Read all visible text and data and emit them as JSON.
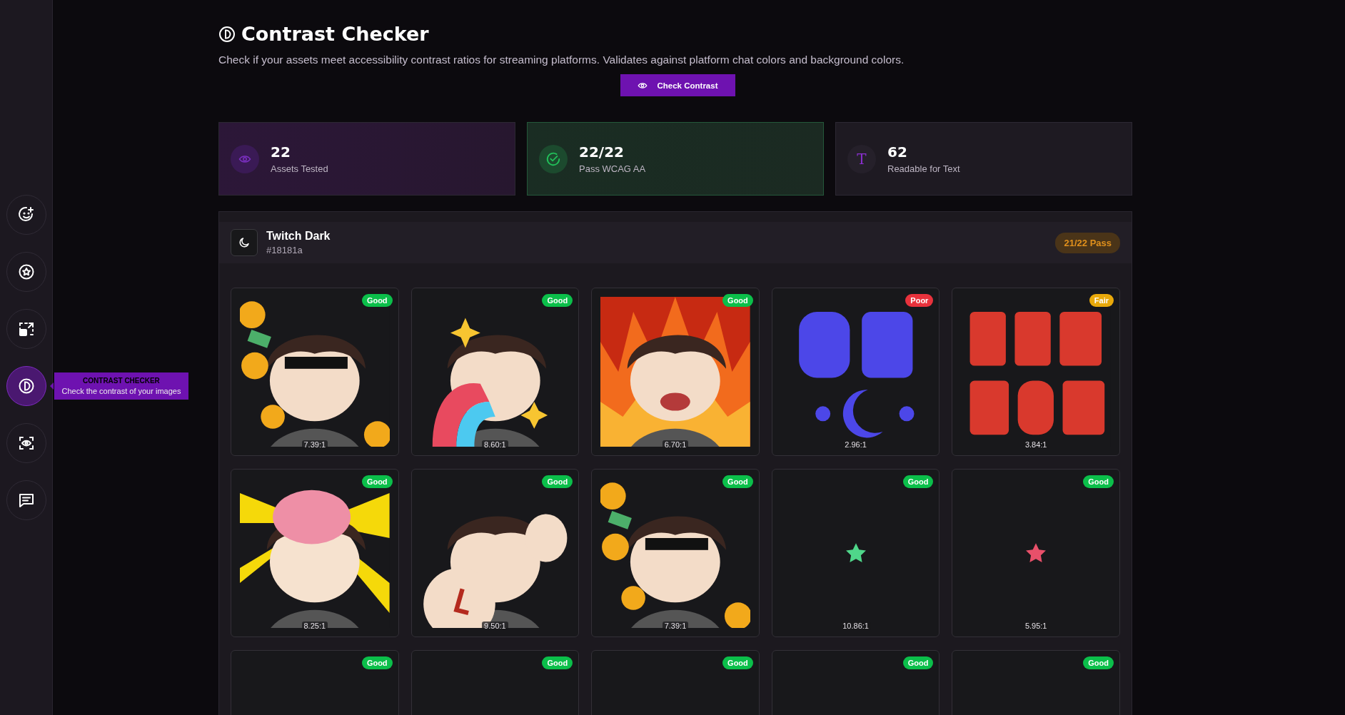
{
  "sidebar": {
    "items": [
      {
        "kind": "emote-add",
        "selected": false
      },
      {
        "kind": "star-badge",
        "selected": false
      },
      {
        "kind": "resize",
        "selected": false
      },
      {
        "kind": "contrast",
        "selected": true
      },
      {
        "kind": "scan",
        "selected": false
      },
      {
        "kind": "chat",
        "selected": false
      }
    ],
    "tooltip": {
      "title": "CONTRAST CHECKER",
      "description": "Check the contrast of your images"
    }
  },
  "header": {
    "title": "Contrast Checker",
    "description": "Check if your assets meet accessibility contrast ratios for streaming platforms. Validates against platform chat colors and background colors.",
    "button": "Check Contrast"
  },
  "stats": [
    {
      "kind": "eye",
      "value": "22",
      "label": "Assets Tested"
    },
    {
      "kind": "check",
      "value": "22/22",
      "label": "Pass WCAG AA"
    },
    {
      "kind": "glyph",
      "glyph": "T",
      "value": "62",
      "label": "Readable for Text"
    }
  ],
  "theme": {
    "name": "Twitch Dark",
    "hex": "#18181a",
    "badge": "21/22 Pass",
    "assets": [
      {
        "kind": "picture",
        "rating": "Good",
        "color": "#0bbf4a",
        "ratio": "7.39:1"
      },
      {
        "kind": "picture",
        "rating": "Good",
        "color": "#0bbf4a",
        "ratio": "8.60:1"
      },
      {
        "kind": "picture",
        "rating": "Good",
        "color": "#0bbf4a",
        "ratio": "6.70:1"
      },
      {
        "kind": "picture",
        "rating": "Poor",
        "color": "#e8323c",
        "ratio": "2.96:1"
      },
      {
        "kind": "picture",
        "rating": "Fair",
        "color": "#e9a90a",
        "ratio": "3.84:1"
      },
      {
        "kind": "picture",
        "rating": "Good",
        "color": "#0bbf4a",
        "ratio": "8.25:1"
      },
      {
        "kind": "picture",
        "rating": "Good",
        "color": "#0bbf4a",
        "ratio": "9.50:1"
      },
      {
        "kind": "picture",
        "rating": "Good",
        "color": "#0bbf4a",
        "ratio": "7.39:1"
      },
      {
        "kind": "star",
        "star": {
          "color": "#4fd68a"
        },
        "rating": "Good",
        "color": "#0bbf4a",
        "ratio": "10.86:1"
      },
      {
        "kind": "star",
        "star": {
          "color": "#e8506a"
        },
        "rating": "Good",
        "color": "#0bbf4a",
        "ratio": "5.95:1"
      },
      {
        "kind": "empty",
        "rating": "Good",
        "color": "#0bbf4a"
      },
      {
        "kind": "empty",
        "rating": "Good",
        "color": "#0bbf4a"
      },
      {
        "kind": "empty",
        "rating": "Good",
        "color": "#0bbf4a"
      },
      {
        "kind": "empty",
        "rating": "Good",
        "color": "#0bbf4a"
      },
      {
        "kind": "empty",
        "rating": "Good",
        "color": "#0bbf4a"
      }
    ]
  }
}
